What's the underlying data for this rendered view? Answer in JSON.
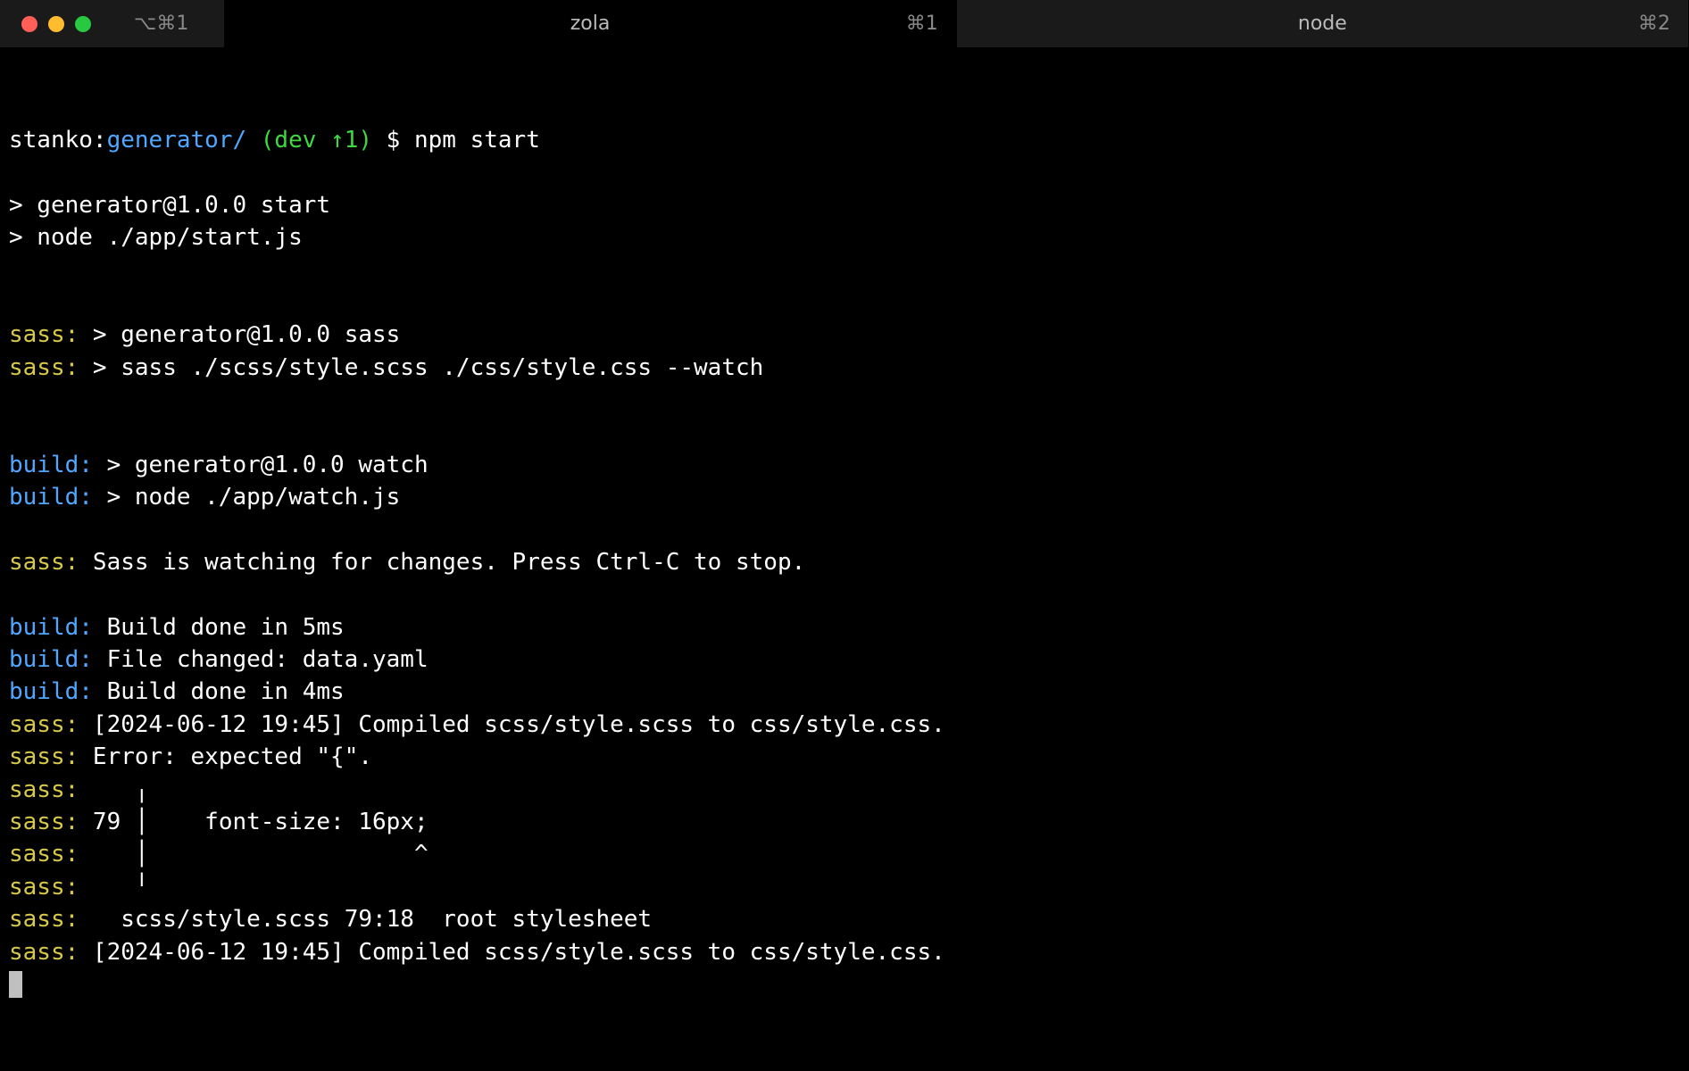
{
  "titlebar": {
    "shortcut_left": "⌥⌘1",
    "tabs": [
      {
        "label": "zola",
        "shortcut": "⌘1",
        "active": true
      },
      {
        "label": "node",
        "shortcut": "⌘2",
        "active": false
      }
    ]
  },
  "prompt": {
    "user": "stanko",
    "sep": ":",
    "path": "generator/",
    "branch": "(dev ↑1)",
    "symbol": "$",
    "command": "npm start"
  },
  "lines": [
    {
      "type": "plain",
      "text": ""
    },
    {
      "type": "plain",
      "text": "> generator@1.0.0 start"
    },
    {
      "type": "plain",
      "text": "> node ./app/start.js"
    },
    {
      "type": "plain",
      "text": ""
    },
    {
      "type": "plain",
      "text": ""
    },
    {
      "type": "labeled",
      "label": "sass:",
      "labelColor": "yellow",
      "text": " > generator@1.0.0 sass"
    },
    {
      "type": "labeled",
      "label": "sass:",
      "labelColor": "yellow",
      "text": " > sass ./scss/style.scss ./css/style.css --watch"
    },
    {
      "type": "plain",
      "text": ""
    },
    {
      "type": "plain",
      "text": ""
    },
    {
      "type": "labeled",
      "label": "build:",
      "labelColor": "blue-label",
      "text": " > generator@1.0.0 watch"
    },
    {
      "type": "labeled",
      "label": "build:",
      "labelColor": "blue-label",
      "text": " > node ./app/watch.js"
    },
    {
      "type": "plain",
      "text": ""
    },
    {
      "type": "labeled",
      "label": "sass:",
      "labelColor": "yellow",
      "text": " Sass is watching for changes. Press Ctrl-C to stop."
    },
    {
      "type": "plain",
      "text": ""
    },
    {
      "type": "labeled",
      "label": "build:",
      "labelColor": "blue-label",
      "text": " Build done in 5ms"
    },
    {
      "type": "labeled",
      "label": "build:",
      "labelColor": "blue-label",
      "text": " File changed: data.yaml"
    },
    {
      "type": "labeled",
      "label": "build:",
      "labelColor": "blue-label",
      "text": " Build done in 4ms"
    },
    {
      "type": "labeled",
      "label": "sass:",
      "labelColor": "yellow",
      "text": " [2024-06-12 19:45] Compiled scss/style.scss to css/style.css."
    },
    {
      "type": "labeled",
      "label": "sass:",
      "labelColor": "yellow",
      "text": " Error: expected \"{\"."
    },
    {
      "type": "labeled",
      "label": "sass:",
      "labelColor": "yellow",
      "text": "    ╷"
    },
    {
      "type": "labeled",
      "label": "sass:",
      "labelColor": "yellow",
      "text": " 79 │    font-size: 16px;"
    },
    {
      "type": "labeled",
      "label": "sass:",
      "labelColor": "yellow",
      "text": "    │                   ^"
    },
    {
      "type": "labeled",
      "label": "sass:",
      "labelColor": "yellow",
      "text": "    ╵"
    },
    {
      "type": "labeled",
      "label": "sass:",
      "labelColor": "yellow",
      "text": "   scss/style.scss 79:18  root stylesheet"
    },
    {
      "type": "labeled",
      "label": "sass:",
      "labelColor": "yellow",
      "text": " [2024-06-12 19:45] Compiled scss/style.scss to css/style.css."
    }
  ]
}
